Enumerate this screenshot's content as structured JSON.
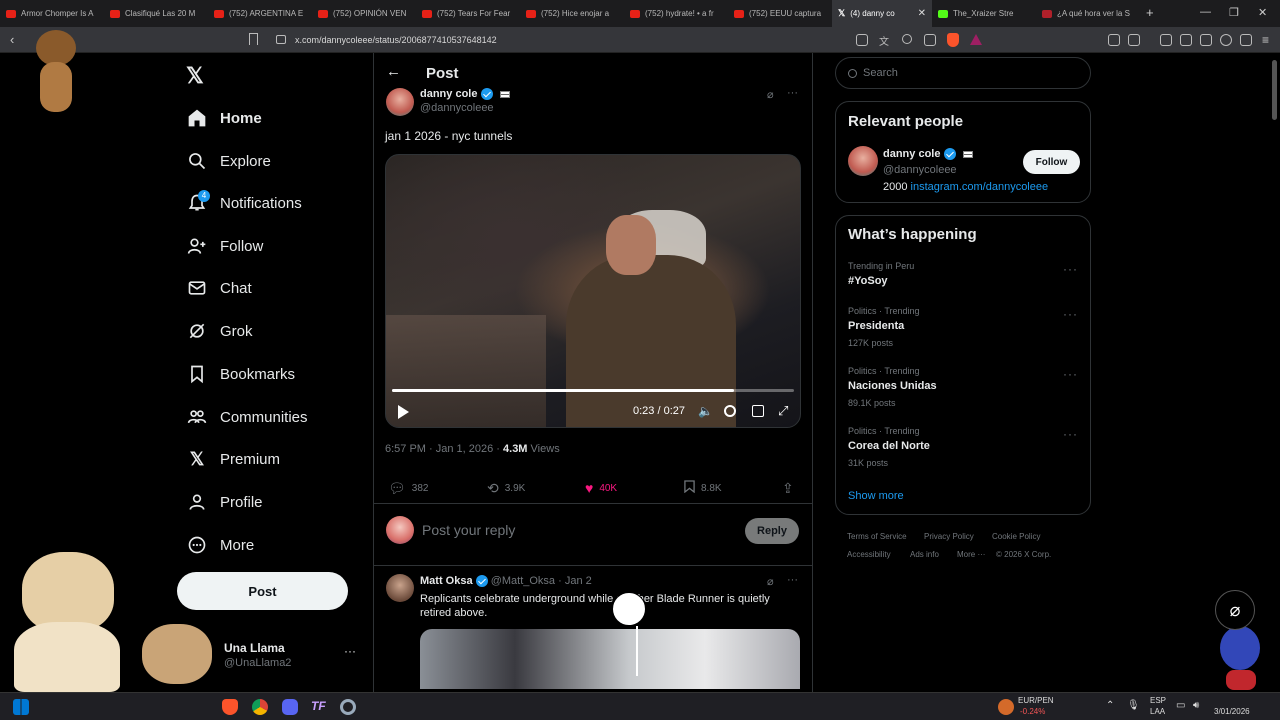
{
  "browser": {
    "tabs": [
      {
        "title": "Armor Chomper Is A",
        "active": false
      },
      {
        "title": "Clasifiqué Las 20 M",
        "active": false
      },
      {
        "title": "(752) ARGENTINA E",
        "active": false
      },
      {
        "title": "(752) OPINIÓN VEN",
        "active": false
      },
      {
        "title": "(752) Tears For Fear",
        "active": false
      },
      {
        "title": "(752) Hice enojar a",
        "active": false
      },
      {
        "title": "(752) hydrate! • a fr",
        "active": false
      },
      {
        "title": "(752) EEUU captura",
        "active": false
      },
      {
        "title": "(4) danny co",
        "active": true
      },
      {
        "title": "The_Xraizer Stre",
        "active": false
      },
      {
        "title": "¿A qué hora ver la S",
        "active": false
      }
    ],
    "url": "x.com/dannycoleee/status/2006877410537648142"
  },
  "nav": {
    "items": [
      {
        "label": "Home",
        "icon": "home-icon"
      },
      {
        "label": "Explore",
        "icon": "search-icon"
      },
      {
        "label": "Notifications",
        "icon": "bell-icon",
        "badge": "4"
      },
      {
        "label": "Follow",
        "icon": "follow-icon"
      },
      {
        "label": "Chat",
        "icon": "mail-icon"
      },
      {
        "label": "Grok",
        "icon": "grok-icon"
      },
      {
        "label": "Bookmarks",
        "icon": "bookmark-icon"
      },
      {
        "label": "Communities",
        "icon": "communities-icon"
      },
      {
        "label": "Premium",
        "icon": "x-logo-icon"
      },
      {
        "label": "Profile",
        "icon": "profile-icon"
      },
      {
        "label": "More",
        "icon": "more-circle-icon"
      }
    ],
    "post_label": "Post",
    "account": {
      "name": "Una Llama",
      "handle": "@UnaLlama2"
    }
  },
  "post": {
    "header_title": "Post",
    "author_name": "danny cole",
    "author_handle": "@dannycoleee",
    "text": "jan 1 2026 - nyc tunnels",
    "video_time": "0:23 / 0:27",
    "video_progress": 0.85,
    "timestamp": "6:57 PM · Jan 1, 2026 · ",
    "views_count": "4.3M",
    "views_label": "Views",
    "replies": "382",
    "reposts": "3.9K",
    "likes": "40K",
    "bookmarks": "8.8K",
    "reply_placeholder": "Post your reply",
    "reply_button": "Reply"
  },
  "reply_tweet": {
    "author_name": "Matt Oksa",
    "author_handle": "@Matt_Oksa",
    "date": "· Jan 2",
    "text": "Replicants celebrate underground while another Blade Runner is quietly retired above."
  },
  "sidebar": {
    "search_placeholder": "Search",
    "relevant_title": "Relevant people",
    "person": {
      "name": "danny cole",
      "handle": "@dannycoleee",
      "bio_prefix": "2000 ",
      "bio_link": "instagram.com/dannycoleee",
      "follow_label": "Follow"
    },
    "happening_title": "What’s happening",
    "trends": [
      {
        "meta": "Trending in Peru",
        "name": "#YoSoy",
        "count": ""
      },
      {
        "meta": "Politics · Trending",
        "name": "Presidenta",
        "count": "127K posts"
      },
      {
        "meta": "Politics · Trending",
        "name": "Naciones Unidas",
        "count": "89.1K posts"
      },
      {
        "meta": "Politics · Trending",
        "name": "Corea del Norte",
        "count": "31K posts"
      }
    ],
    "show_more": "Show more",
    "footer": [
      "Terms of Service",
      "Privacy Policy",
      "Cookie Policy",
      "Accessibility",
      "Ads info",
      "More ···",
      "© 2026 X Corp."
    ]
  },
  "taskbar": {
    "ticker_name": "EUR/PEN",
    "ticker_change": "-0.24%",
    "lang1": "ESP",
    "lang2": "LAA",
    "date": "3/01/2026"
  },
  "colors": {
    "background": "#000000",
    "accent": "#1d9bf0",
    "like": "#f91880",
    "border": "#2f3336"
  }
}
